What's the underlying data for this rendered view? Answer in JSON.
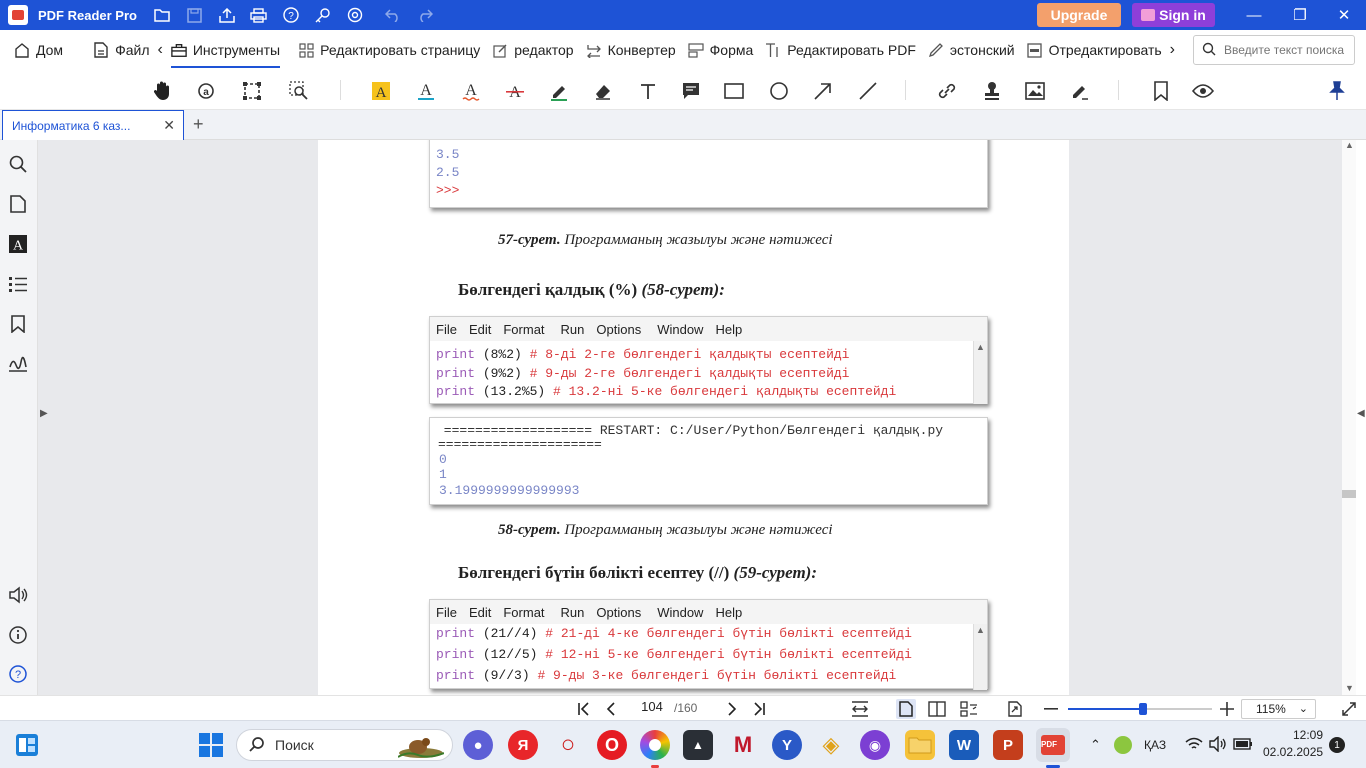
{
  "titlebar": {
    "app_name": "PDF Reader Pro",
    "upgrade_label": "Upgrade",
    "signin_label": "Sign in",
    "minimize": "—",
    "restore": "❐",
    "close": "✕"
  },
  "menu": {
    "items": [
      {
        "label": "Дом",
        "icon": "home-icon"
      },
      {
        "label": "Файл",
        "icon": "file-icon"
      },
      {
        "label": "Инструменты",
        "icon": "toolbox-icon"
      },
      {
        "label": "Редактировать страницу",
        "icon": "grid-icon"
      },
      {
        "label": "редактор",
        "icon": "edit-icon"
      },
      {
        "label": "Конвертер",
        "icon": "convert-icon"
      },
      {
        "label": "Форма",
        "icon": "form-icon"
      },
      {
        "label": "Редактировать PDF",
        "icon": "text-edit-icon"
      },
      {
        "label": "эстонский",
        "icon": "pen-icon"
      },
      {
        "label": "Отредактировать",
        "icon": "redact-icon"
      }
    ],
    "search_placeholder": "Введите текст поиска"
  },
  "tabs": {
    "doc_tab": "Информатика 6 каз...",
    "close": "✕",
    "new": "+"
  },
  "page_content": {
    "top_output": [
      "3.5",
      "2.5",
      ">>>"
    ],
    "caption57_num": "57-сурет.",
    "caption57_text": " Программаның жазылуы және нәтижесі",
    "heading58_text": "Бөлгендегі қалдық (%) ",
    "heading58_ref": "(58-сурет):",
    "ide_menu": [
      "File",
      "Edit",
      "Format",
      "Run",
      "Options",
      "Window",
      "Help"
    ],
    "code58": [
      {
        "kw": "print",
        "arg": " (8%2) ",
        "comment": "# 8-ді 2-ге бөлгендегі қалдықты есептейді"
      },
      {
        "kw": "print",
        "arg": " (9%2) ",
        "comment": "# 9-ды 2-ге бөлгендегі қалдықты есептейді"
      },
      {
        "kw": "print",
        "arg": " (13.2%5) ",
        "comment": "# 13.2-ні 5-ке бөлгендегі қалдықты есептейді"
      }
    ],
    "restart_line1": " =================== RESTART: C:/User/Python/Бөлгендегі қалдық.py",
    "restart_line2": "=====================",
    "output58": [
      "0",
      "1",
      "3.1999999999999993"
    ],
    "caption58_num": "58-сурет.",
    "caption58_text": " Программаның жазылуы және нәтижесі",
    "heading59_text": "Бөлгендегі бүтін бөлікті есептеу (//) ",
    "heading59_ref": "(59-сурет):",
    "code59": [
      {
        "kw": "print",
        "arg": " (21//4) ",
        "comment": "# 21-ді 4-ке бөлгендегі бүтін бөлікті есептейді"
      },
      {
        "kw": "print",
        "arg": " (12//5) ",
        "comment": "# 12-ні 5-ке бөлгендегі бүтін бөлікті есептейді"
      },
      {
        "kw": "print",
        "arg": " (9//3) ",
        "comment": "# 9-ды 3-ке бөлгендегі бүтін бөлікті есептейді"
      }
    ]
  },
  "statusbar": {
    "current_page": "104",
    "total_pages": "/160",
    "zoom": "115%",
    "zoom_fraction": 0.52
  },
  "taskbar": {
    "search_label": "Поиск",
    "lang": "ҚАЗ",
    "time": "12:09",
    "date": "02.02.2025",
    "notification_count": "1"
  },
  "colors": {
    "brand": "#1e53d6",
    "upgrade": "#f3a06c",
    "signin": "#8e3fd9"
  }
}
